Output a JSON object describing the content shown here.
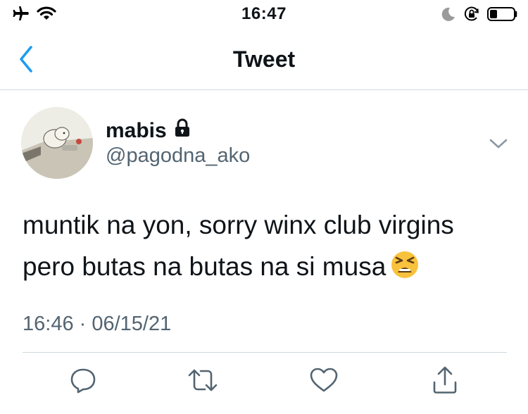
{
  "status_bar": {
    "time": "16:47",
    "icons": [
      "airplane-icon",
      "wifi-icon",
      "moon-icon",
      "orientation-lock-icon",
      "battery-icon"
    ]
  },
  "nav": {
    "title": "Tweet",
    "back_icon": "chevron-left-icon"
  },
  "tweet": {
    "author": {
      "display_name": "mabis",
      "handle": "@pagodna_ako",
      "protected_icon": "lock-icon"
    },
    "text_line1": "muntik na yon, sorry winx club virgins",
    "text_line2": "pero butas na butas na si musa",
    "emoji": "tired-face-emoji",
    "timestamp": "16:46 · 06/15/21"
  },
  "actions": [
    "reply-icon",
    "retweet-icon",
    "like-icon",
    "share-icon"
  ],
  "colors": {
    "accent": "#1d9bf0",
    "text": "#0f1419",
    "muted": "#536471",
    "divider": "#cfd9de",
    "icon": "#536471"
  }
}
